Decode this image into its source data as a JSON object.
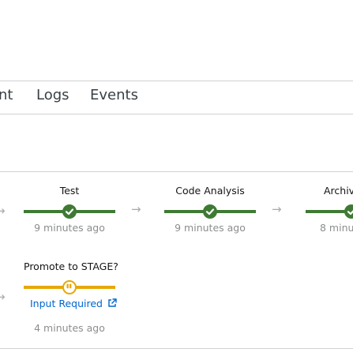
{
  "tabs": [
    {
      "label": "nt"
    },
    {
      "label": "Logs"
    },
    {
      "label": "Events"
    }
  ],
  "pipeline": {
    "row1": [
      {
        "name": "Test",
        "time": "9 minutes ago",
        "status": "success"
      },
      {
        "name": "Code Analysis",
        "time": "9 minutes ago",
        "status": "success"
      },
      {
        "name": "Archiv",
        "time": "8 minu",
        "status": "success"
      }
    ],
    "row2": [
      {
        "name": "Promote to STAGE?",
        "link": "Input Required",
        "time": "4 minutes ago",
        "status": "paused"
      }
    ]
  },
  "colors": {
    "success": "#3f7a34",
    "paused": "#e6a807",
    "link": "#0066cc"
  }
}
